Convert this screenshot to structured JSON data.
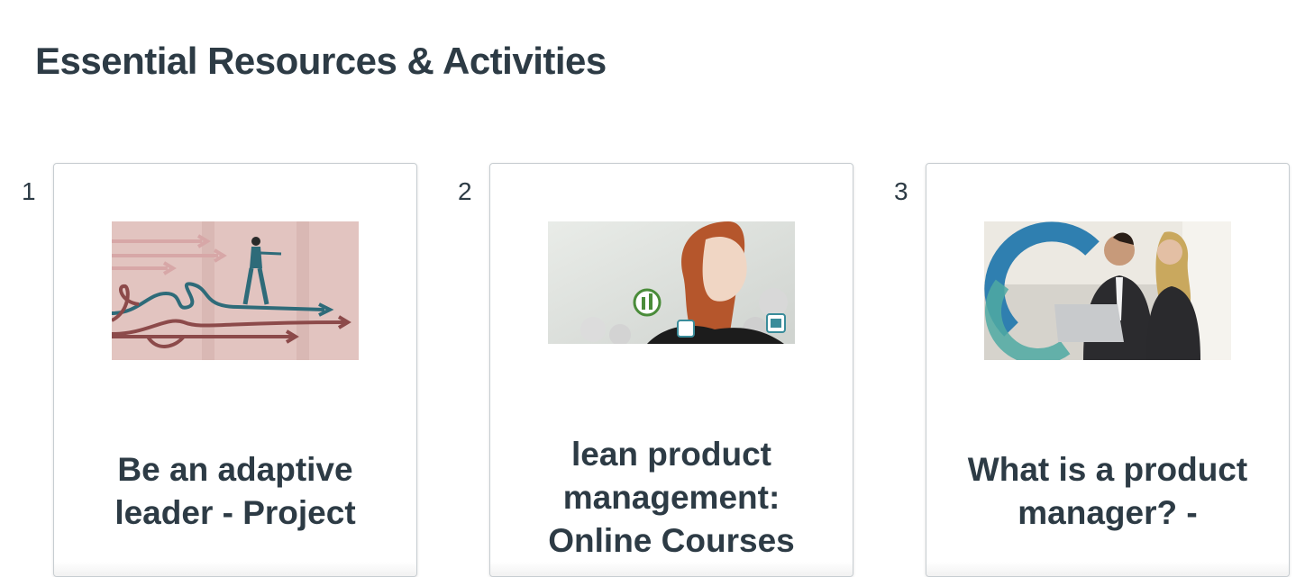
{
  "section": {
    "title": "Essential Resources & Activities"
  },
  "cards": [
    {
      "index": "1",
      "title_lines": [
        "Be an adaptive",
        "leader - Project"
      ],
      "image": "adaptive-leader-illustration"
    },
    {
      "index": "2",
      "title_lines": [
        "lean product",
        "management:",
        "Online Courses"
      ],
      "image": "woman-portrait-banner"
    },
    {
      "index": "3",
      "title_lines": [
        "What is a product",
        "manager? -"
      ],
      "image": "business-people-laptop-photo"
    }
  ],
  "colors": {
    "text": "#2d3b45",
    "card_border": "#c7cdd1",
    "illustration_bg": "#e2c4c0",
    "teal": "#2e6b79",
    "maroon": "#8c4a4a"
  }
}
